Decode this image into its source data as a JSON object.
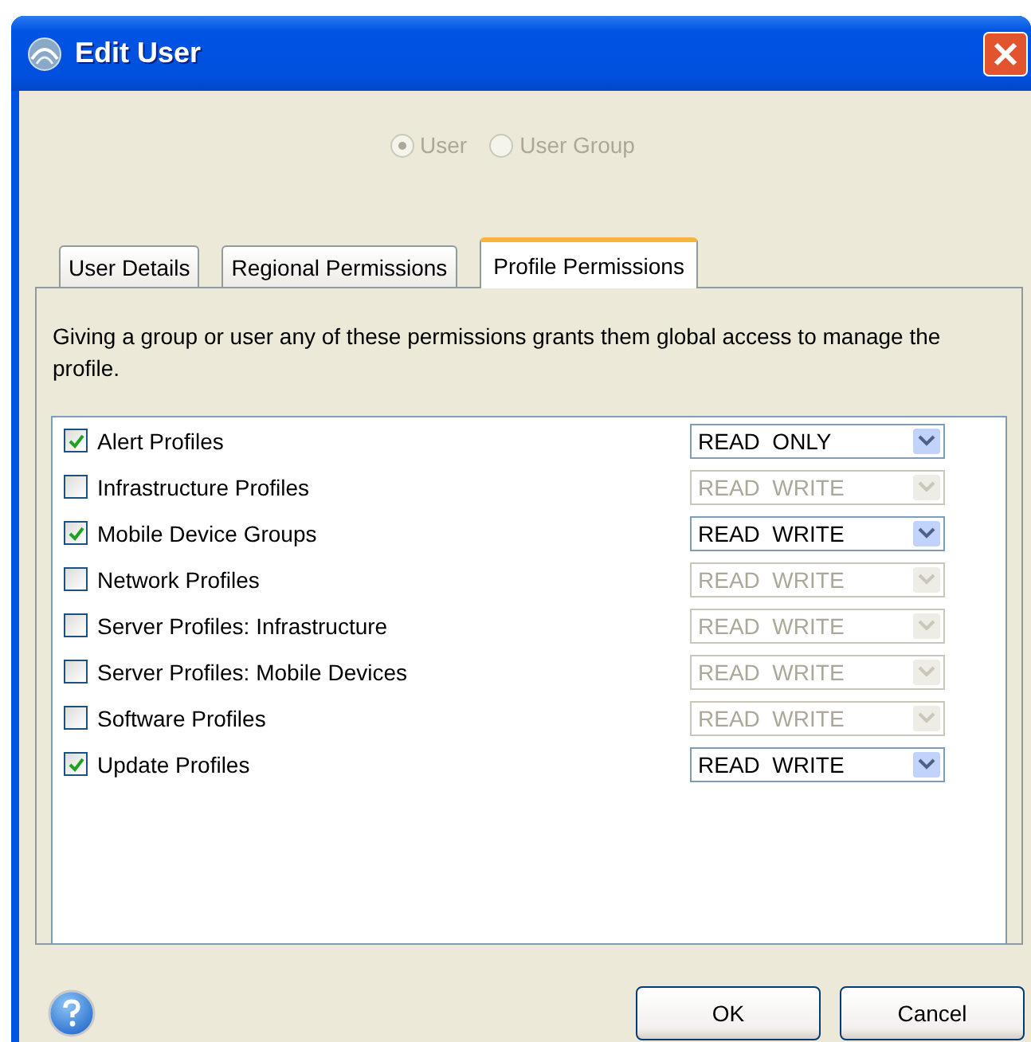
{
  "window": {
    "title": "Edit User"
  },
  "user_type": [
    {
      "label": "User",
      "selected": true,
      "disabled": true
    },
    {
      "label": "User Group",
      "selected": false,
      "disabled": true
    }
  ],
  "tabs": [
    {
      "label": "User Details",
      "selected": false
    },
    {
      "label": "Regional Permissions",
      "selected": false
    },
    {
      "label": "Profile Permissions",
      "selected": true
    }
  ],
  "description": "Giving a group or user any of these permissions grants them global access to manage the profile.",
  "profiles": [
    {
      "name": "Alert Profiles",
      "checked": true,
      "access": "READ  ONLY",
      "disabled": false
    },
    {
      "name": "Infrastructure Profiles",
      "checked": false,
      "access": "READ  WRITE",
      "disabled": true
    },
    {
      "name": "Mobile Device Groups",
      "checked": true,
      "access": "READ  WRITE",
      "disabled": false
    },
    {
      "name": "Network Profiles",
      "checked": false,
      "access": "READ  WRITE",
      "disabled": true
    },
    {
      "name": "Server Profiles: Infrastructure",
      "checked": false,
      "access": "READ  WRITE",
      "disabled": true
    },
    {
      "name": "Server Profiles: Mobile Devices",
      "checked": false,
      "access": "READ  WRITE",
      "disabled": true
    },
    {
      "name": "Software Profiles",
      "checked": false,
      "access": "READ  WRITE",
      "disabled": true
    },
    {
      "name": "Update Profiles",
      "checked": true,
      "access": "READ  WRITE",
      "disabled": false
    }
  ],
  "buttons": [
    "OK",
    "Cancel"
  ]
}
